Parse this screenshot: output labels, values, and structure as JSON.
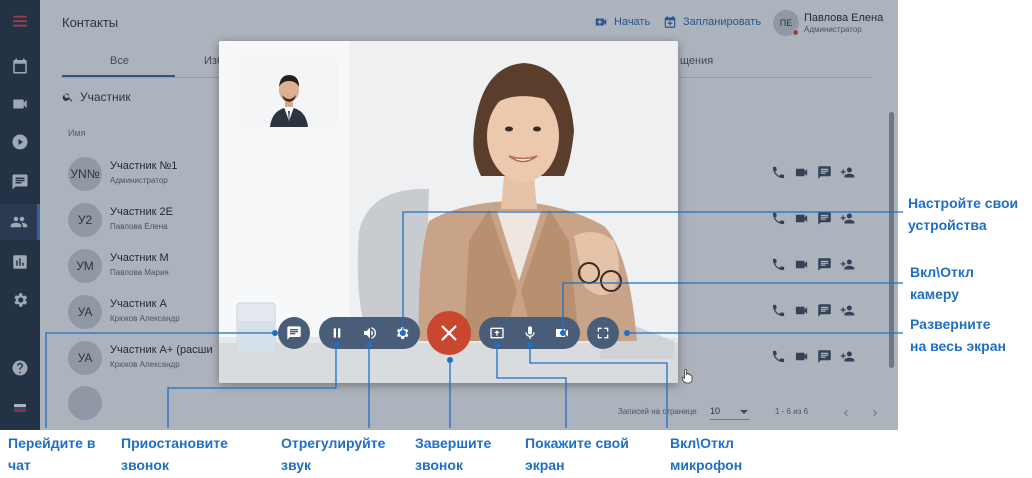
{
  "topbar": {
    "title": "Контакты",
    "start_label": "Начать",
    "schedule_label": "Запланировать",
    "user_initials": "ПЕ",
    "user_name": "Павлова Елена",
    "user_role": "Администратор"
  },
  "tabs": [
    {
      "label": "Все"
    },
    {
      "label": "Изб"
    },
    {
      "label": "щения"
    }
  ],
  "search": {
    "label": "Участник"
  },
  "table": {
    "column_name": "Имя",
    "rows": [
      {
        "initials": "УN№",
        "name": "Участник №1",
        "sub": "Администратор"
      },
      {
        "initials": "У2",
        "name": "Участник 2Е",
        "sub": "Павлова Елена"
      },
      {
        "initials": "УМ",
        "name": "Участник М",
        "sub": "Павлова Мария"
      },
      {
        "initials": "УА",
        "name": "Участник А",
        "sub": "Крюков Александр"
      },
      {
        "initials": "УА",
        "name": "Участник А+ (расши",
        "sub": "Крюков Александр"
      }
    ]
  },
  "pager": {
    "label": "Записей на странице",
    "size": "10",
    "range": "1 - 6 из 6"
  },
  "sidebar": {
    "icons": [
      "menu-icon",
      "calendar-icon",
      "video-icon",
      "play-icon",
      "chat-icon",
      "contacts-icon",
      "chart-icon",
      "settings-icon",
      "help-icon"
    ],
    "active": "contacts-icon"
  },
  "colors": {
    "sidebar": "#233040",
    "accent": "#2767b8",
    "callout": "#1f6fc5",
    "end_call": "#c9472f",
    "control": "#4a5d78"
  },
  "callouts": {
    "devices": "Настройте свои\nустройства",
    "camera": "Вкл\\Откл\nкамеру",
    "fullscreen": "Разверните\nна весь экран",
    "chat": "Перейдите в\nчат",
    "pause": "Приостановите\nзвонок",
    "volume": "Отрегулируйте\nзвук",
    "end": "Завершите\nзвонок",
    "share": "Покажите свой\nэкран",
    "mic": "Вкл\\Откл\nмикрофон"
  }
}
